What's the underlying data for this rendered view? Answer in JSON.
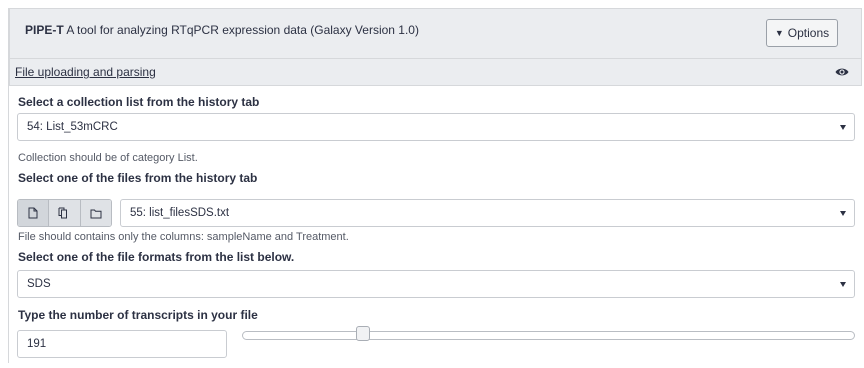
{
  "tool": {
    "name": "PIPE-T",
    "description": "A tool for analyzing RTqPCR expression data (Galaxy Version 1.0)",
    "options_label": "Options"
  },
  "section": {
    "title": "File uploading and parsing",
    "icon": "eye-icon"
  },
  "collection": {
    "label": "Select a collection list from the history tab",
    "value": "54: List_53mCRC",
    "help": "Collection should be of category List."
  },
  "file": {
    "label": "Select one of the files from the history tab",
    "source_buttons": [
      "single-file-icon",
      "multiple-files-icon",
      "folder-icon"
    ],
    "value": "55: list_filesSDS.txt",
    "help": "File should contains only the columns: sampleName and Treatment."
  },
  "format": {
    "label": "Select one of the file formats from the list below.",
    "value": "SDS"
  },
  "transcripts": {
    "label": "Type the number of transcripts in your file",
    "value": "191",
    "slider_fraction": 0.19
  }
}
